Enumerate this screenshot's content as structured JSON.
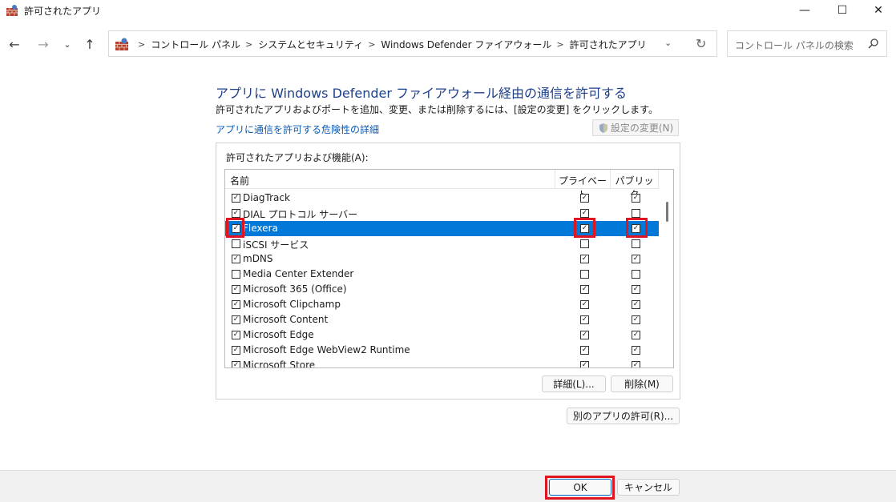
{
  "window": {
    "title": "許可されたアプリ",
    "minimize_symbol": "—",
    "maximize_symbol": "☐",
    "close_symbol": "✕"
  },
  "nav": {
    "back_symbol": "←",
    "forward_symbol": "→",
    "recent_symbol": "⌄",
    "up_symbol": "↑"
  },
  "address": {
    "crumbs": [
      "コントロール パネル",
      "システムとセキュリティ",
      "Windows Defender ファイアウォール",
      "許可されたアプリ"
    ],
    "separator": ">",
    "dropdown_symbol": "⌄",
    "refresh_symbol": "↻"
  },
  "search": {
    "placeholder": "コントロール パネルの検索"
  },
  "main": {
    "title": "アプリに Windows Defender ファイアウォール経由の通信を許可する",
    "description": "許可されたアプリおよびポートを追加、変更、または削除するには、[設定の変更] をクリックします。",
    "risk_link": "アプリに通信を許可する危険性の詳細",
    "change_settings_label": "設定の変更(N)"
  },
  "apps_group": {
    "label": "許可されたアプリおよび機能(A):",
    "columns": {
      "name": "名前",
      "private": "プライベート",
      "public": "パブリック"
    },
    "rows": [
      {
        "name": "DiagTrack",
        "enabled": true,
        "private": true,
        "public": true
      },
      {
        "name": "DIAL プロトコル サーバー",
        "enabled": true,
        "private": true,
        "public": false
      },
      {
        "name": "Flexera",
        "enabled": true,
        "private": true,
        "public": true,
        "selected": true
      },
      {
        "name": "iSCSI サービス",
        "enabled": false,
        "private": false,
        "public": false
      },
      {
        "name": "mDNS",
        "enabled": true,
        "private": true,
        "public": true
      },
      {
        "name": "Media Center Extender",
        "enabled": false,
        "private": false,
        "public": false
      },
      {
        "name": "Microsoft 365 (Office)",
        "enabled": true,
        "private": true,
        "public": true
      },
      {
        "name": "Microsoft Clipchamp",
        "enabled": true,
        "private": true,
        "public": true
      },
      {
        "name": "Microsoft Content",
        "enabled": true,
        "private": true,
        "public": true
      },
      {
        "name": "Microsoft Edge",
        "enabled": true,
        "private": true,
        "public": true
      },
      {
        "name": "Microsoft Edge WebView2 Runtime",
        "enabled": true,
        "private": true,
        "public": true
      },
      {
        "name": "Microsoft Store",
        "enabled": true,
        "private": true,
        "public": true
      }
    ],
    "details_button": "詳細(L)...",
    "delete_button": "削除(M)"
  },
  "allow_other_button": "別のアプリの許可(R)...",
  "footer": {
    "ok_button": "OK",
    "cancel_button": "キャンセル"
  },
  "colors": {
    "selection": "#0078d7",
    "highlight_box": "#e0151f",
    "title_text": "#1e3f8a",
    "link": "#0a5bb5"
  }
}
